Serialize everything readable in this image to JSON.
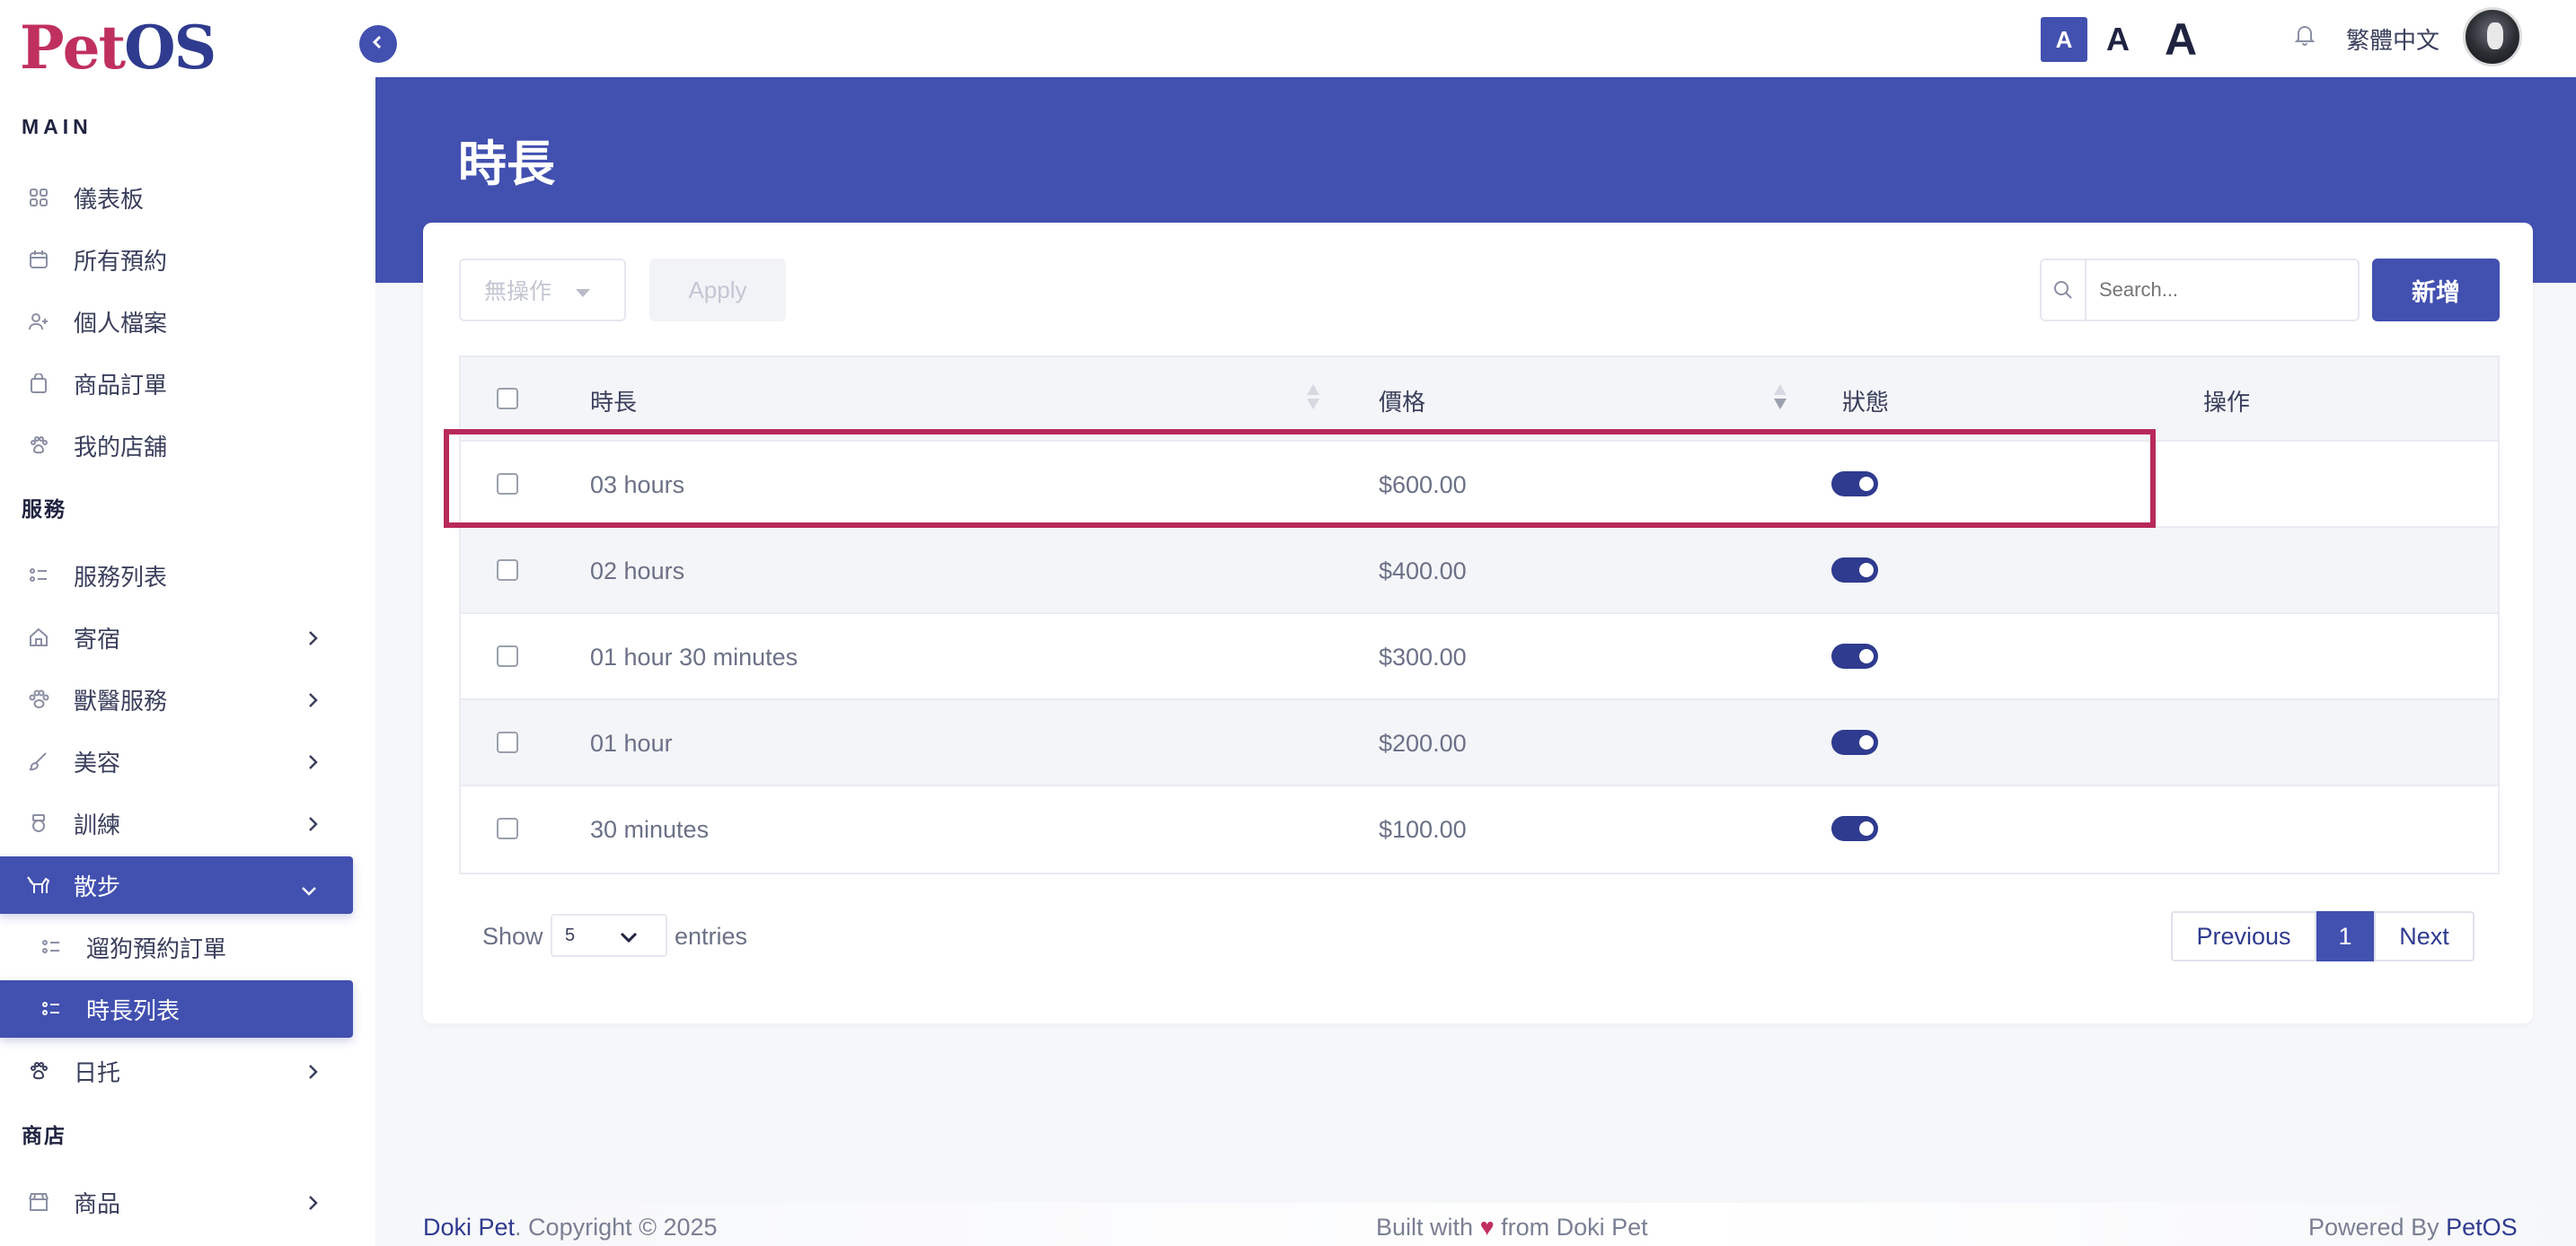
{
  "brand": {
    "logo_p": "P",
    "logo_et": "et",
    "logo_os": "OS"
  },
  "sidebar": {
    "main_title": "MAIN",
    "main_items": [
      {
        "label": "儀表板",
        "icon": "grid-icon"
      },
      {
        "label": "所有預約",
        "icon": "calendar-icon"
      },
      {
        "label": "個人檔案",
        "icon": "user-plus-icon"
      },
      {
        "label": "商品訂單",
        "icon": "bag-icon"
      },
      {
        "label": "我的店舖",
        "icon": "paw-icon"
      }
    ],
    "service_title": "服務",
    "service_items": [
      {
        "label": "服務列表",
        "icon": "list-icon"
      },
      {
        "label": "寄宿",
        "icon": "home-icon"
      },
      {
        "label": "獸醫服務",
        "icon": "vet-paw-icon"
      },
      {
        "label": "美容",
        "icon": "brush-icon"
      },
      {
        "label": "訓練",
        "icon": "medal-icon"
      },
      {
        "label": "散步",
        "icon": "dog-walk-icon"
      },
      {
        "label": "遛狗預約訂單",
        "icon": "list-icon"
      },
      {
        "label": "時長列表",
        "icon": "list-icon"
      },
      {
        "label": "日托",
        "icon": "paw-icon"
      }
    ],
    "shop_title": "商店",
    "shop_items": [
      {
        "label": "商品",
        "icon": "store-icon"
      }
    ]
  },
  "topbar": {
    "font_small": "A",
    "font_mid": "A",
    "font_big": "A",
    "language": "繁體中文"
  },
  "page": {
    "title": "時長"
  },
  "toolbar": {
    "bulk_action": "無操作",
    "apply_label": "Apply",
    "search_placeholder": "Search...",
    "add_label": "新增"
  },
  "table": {
    "headers": {
      "duration": "時長",
      "price": "價格",
      "status": "狀態",
      "actions": "操作"
    },
    "rows": [
      {
        "duration": "03 hours",
        "price": "$600.00",
        "status_on": true
      },
      {
        "duration": "02 hours",
        "price": "$400.00",
        "status_on": true
      },
      {
        "duration": "01 hour 30 minutes",
        "price": "$300.00",
        "status_on": true
      },
      {
        "duration": "01 hour",
        "price": "$200.00",
        "status_on": true
      },
      {
        "duration": "30 minutes",
        "price": "$100.00",
        "status_on": true
      }
    ]
  },
  "pagination": {
    "show_label": "Show",
    "entries_value": "5",
    "entries_label": "entries",
    "previous": "Previous",
    "current_page": "1",
    "next": "Next"
  },
  "footer": {
    "left_brand": "Doki Pet",
    "left_rest": ". Copyright © 2025",
    "mid_pre": "Built with",
    "mid_heart": "♥",
    "mid_post": "from Doki Pet",
    "right_pre": "Powered By",
    "right_brand": "PetOS"
  },
  "colors": {
    "accent": "#4250b0",
    "brand_pink": "#c0305f",
    "highlight": "#b8295a"
  }
}
